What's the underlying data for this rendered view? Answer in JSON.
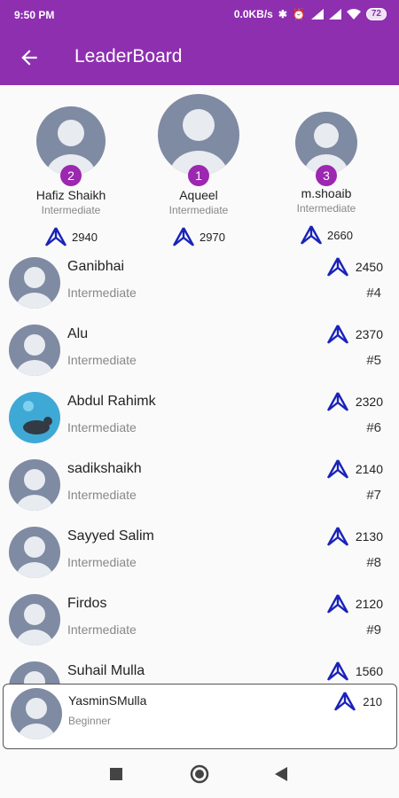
{
  "status": {
    "time": "9:50 PM",
    "net": "0.0KB/s",
    "battery": "72"
  },
  "appbar": {
    "title": "LeaderBoard"
  },
  "podium": [
    {
      "rank": "2",
      "name": "Hafiz Shaikh",
      "level": "Intermediate",
      "score": "2940"
    },
    {
      "rank": "1",
      "name": "Aqueel",
      "level": "Intermediate",
      "score": "2970"
    },
    {
      "rank": "3",
      "name": "m.shoaib",
      "level": "Intermediate",
      "score": "2660"
    }
  ],
  "list": [
    {
      "name": "Ganibhai",
      "level": "Intermediate",
      "score": "2450",
      "rank": "#4"
    },
    {
      "name": "Alu",
      "level": "Intermediate",
      "score": "2370",
      "rank": "#5"
    },
    {
      "name": "Abdul Rahimk",
      "level": "Intermediate",
      "score": "2320",
      "rank": "#6"
    },
    {
      "name": "sadikshaikh",
      "level": "Intermediate",
      "score": "2140",
      "rank": "#7"
    },
    {
      "name": "Sayyed Salim",
      "level": "Intermediate",
      "score": "2130",
      "rank": "#8"
    },
    {
      "name": "Firdos",
      "level": "Intermediate",
      "score": "2120",
      "rank": "#9"
    },
    {
      "name": "Suhail Mulla",
      "score": "1560"
    }
  ],
  "me": {
    "name": "YasminSMulla",
    "level": "Beginner",
    "score": "210"
  },
  "colors": {
    "primary": "#8e2fb0",
    "badge": "#9c27b0",
    "score_icon": "#1a23b8"
  }
}
